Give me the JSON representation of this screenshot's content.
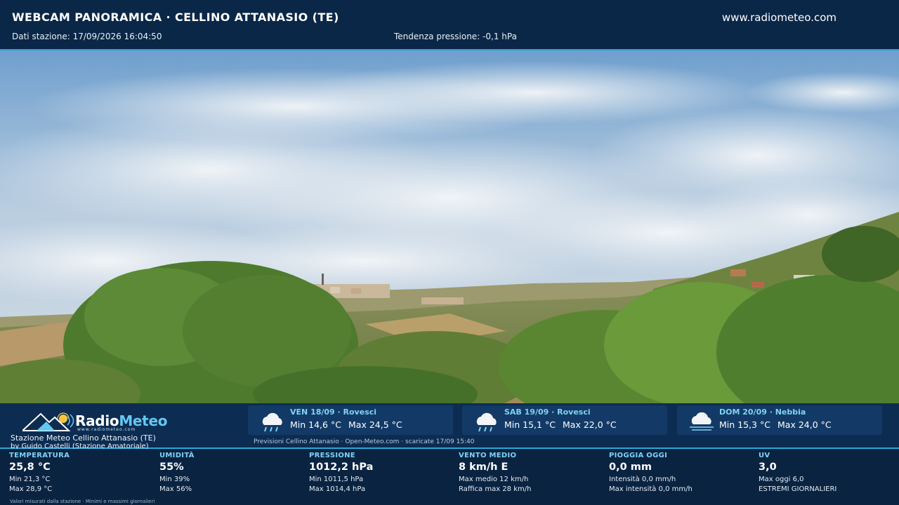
{
  "header": {
    "title": "WEBCAM PANORAMICA · CELLINO ATTANASIO (TE)",
    "site": "www.radiometeo.com",
    "station_data": "Dati stazione: 17/09/2026 16:04:50",
    "pressure_trend": "Tendenza pressione: -0,1 hPa"
  },
  "brand": {
    "name_part1": "Radio",
    "name_part2": "Meteo",
    "url": "www.radiometeo.com",
    "station": "Stazione Meteo Cellino Attanasio (TE)",
    "by": "by Guido Castelli (Stazione Amatoriale)"
  },
  "forecast": {
    "days": [
      {
        "day": "VEN 18/09 · Rovesci",
        "min": "Min 14,6 °C",
        "max": "Max 24,5 °C",
        "icon": "rain-cloud-icon"
      },
      {
        "day": "SAB 19/09 · Rovesci",
        "min": "Min 15,1 °C",
        "max": "Max 22,0 °C",
        "icon": "rain-cloud-icon"
      },
      {
        "day": "DOM 20/09 · Nebbia",
        "min": "Min 15,3 °C",
        "max": "Max 24,0 °C",
        "icon": "fog-cloud-icon"
      }
    ],
    "note": "Previsioni Cellino Attanasio · Open-Meteo.com · scaricate 17/09 15:40"
  },
  "stats": [
    {
      "label": "TEMPERATURA",
      "value": "25,8 °C",
      "sub1": "Min 21,3 °C",
      "sub2": "Max 28,9 °C"
    },
    {
      "label": "UMIDITÀ",
      "value": "55%",
      "sub1": "Min 39%",
      "sub2": "Max 56%"
    },
    {
      "label": "PRESSIONE",
      "value": "1012,2 hPa",
      "sub1": "Min 1011,5 hPa",
      "sub2": "Max 1014,4 hPa"
    },
    {
      "label": "VENTO MEDIO",
      "value": "8 km/h E",
      "sub1": "Max medio 12 km/h",
      "sub2": "Raffica max 28 km/h"
    },
    {
      "label": "PIOGGIA OGGI",
      "value": "0,0 mm",
      "sub1": "Intensità 0,0 mm/h",
      "sub2": "Max intensità 0,0 mm/h"
    },
    {
      "label": "UV",
      "value": "3,0",
      "sub1": "Max oggi 6,0",
      "sub2": "ESTREMI GIORNALIERI"
    }
  ],
  "footnote": "Valori misurati dalla stazione · Minimi e massimi giornalieri",
  "colors": {
    "accent": "#2aa7d8",
    "label": "#7fd3f5",
    "background": "#0b2747"
  }
}
